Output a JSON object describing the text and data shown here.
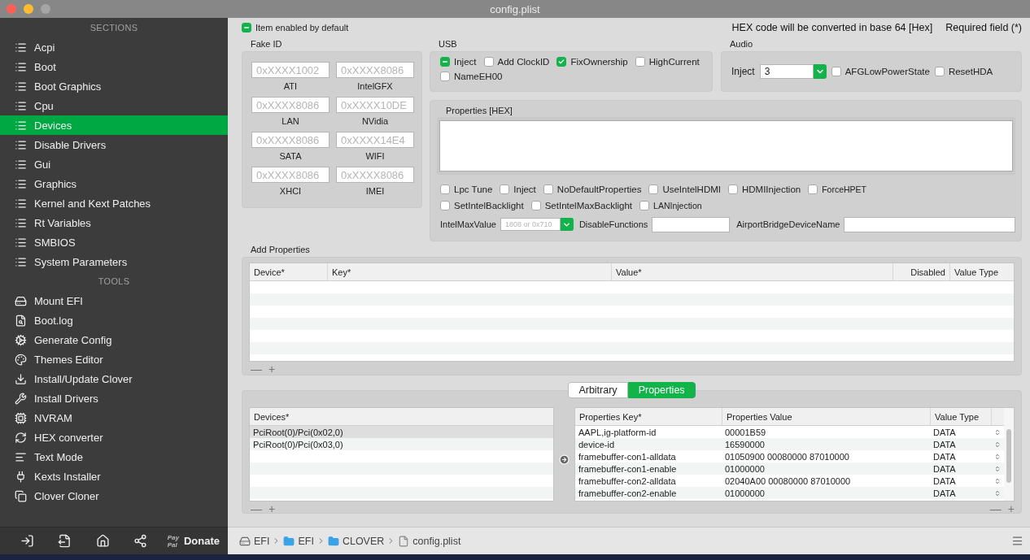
{
  "window": {
    "title": "config.plist"
  },
  "sidebar": {
    "sections_header": "SECTIONS",
    "sections": [
      {
        "label": "Acpi",
        "selected": false
      },
      {
        "label": "Boot",
        "selected": false
      },
      {
        "label": "Boot Graphics",
        "selected": false
      },
      {
        "label": "Cpu",
        "selected": false
      },
      {
        "label": "Devices",
        "selected": true
      },
      {
        "label": "Disable Drivers",
        "selected": false
      },
      {
        "label": "Gui",
        "selected": false
      },
      {
        "label": "Graphics",
        "selected": false
      },
      {
        "label": "Kernel and Kext Patches",
        "selected": false
      },
      {
        "label": "Rt Variables",
        "selected": false
      },
      {
        "label": "SMBIOS",
        "selected": false
      },
      {
        "label": "System Parameters",
        "selected": false
      }
    ],
    "tools_header": "TOOLS",
    "tools": [
      "Mount EFI",
      "Boot.log",
      "Generate Config",
      "Themes Editor",
      "Install/Update Clover",
      "Install Drivers",
      "NVRAM",
      "HEX converter",
      "Text Mode",
      "Kexts Installer",
      "Clover Cloner"
    ],
    "donate": {
      "logo_top": "Pay",
      "logo_bottom": "Pal",
      "label": "Donate"
    }
  },
  "item_enabled": {
    "label": "Item enabled by default",
    "checked": true,
    "partial": true
  },
  "notes": [
    "HEX code will be converted in base 64 [Hex]",
    "Required field (*)"
  ],
  "fake_id": {
    "title": "Fake ID",
    "fields": [
      {
        "placeholder": "0xXXXX1002",
        "label": "ATI"
      },
      {
        "placeholder": "0xXXXX8086",
        "label": "IntelGFX"
      },
      {
        "placeholder": "0xXXXX8086",
        "label": "LAN"
      },
      {
        "placeholder": "0xXXXX10DE",
        "label": "NVidia"
      },
      {
        "placeholder": "0xXXXX8086",
        "label": "SATA"
      },
      {
        "placeholder": "0xXXXX14E4",
        "label": "WIFI"
      },
      {
        "placeholder": "0xXXXX8086",
        "label": "XHCI"
      },
      {
        "placeholder": "0xXXXX8086",
        "label": "IMEI"
      }
    ]
  },
  "usb": {
    "title": "USB",
    "options": [
      {
        "label": "Inject",
        "checked": true,
        "partial": true
      },
      {
        "label": "Add ClockID",
        "checked": false,
        "partial": false
      },
      {
        "label": "FixOwnership",
        "checked": true,
        "partial": false
      },
      {
        "label": "HighCurrent",
        "checked": false,
        "partial": false
      },
      {
        "label": "NameEH00",
        "checked": false,
        "partial": false
      }
    ]
  },
  "audio": {
    "title": "Audio",
    "inject_label": "Inject",
    "inject_value": "3",
    "options": [
      {
        "label": "AFGLowPowerState",
        "checked": false
      },
      {
        "label": "ResetHDA",
        "checked": false
      }
    ]
  },
  "properties_hex": {
    "title": "Properties [HEX]",
    "options_row_1": [
      {
        "label": "Lpc Tune",
        "checked": false
      },
      {
        "label": "Inject",
        "checked": false
      },
      {
        "label": "NoDefaultProperties",
        "checked": false
      },
      {
        "label": "UseIntelHDMI",
        "checked": false
      },
      {
        "label": "HDMIInjection",
        "checked": false
      },
      {
        "label": "ForceHPET",
        "checked": false
      }
    ],
    "options_row_2": [
      {
        "label": "SetIntelBacklight",
        "checked": false
      },
      {
        "label": "SetIntelMaxBacklight",
        "checked": false
      },
      {
        "label": "LANInjection",
        "checked": false
      }
    ],
    "intel_max_value": {
      "label": "IntelMaxValue",
      "placeholder": "1808 or 0x710"
    },
    "disable_functions": {
      "label": "DisableFunctions"
    },
    "airport_bridge": {
      "label": "AirportBridgeDeviceName"
    }
  },
  "add_properties": {
    "title": "Add Properties",
    "columns": [
      "Device*",
      "Key*",
      "Value*",
      "Disabled",
      "Value Type"
    ],
    "remove": "—",
    "add": "+"
  },
  "segments": [
    {
      "label": "Arbitrary",
      "selected": false
    },
    {
      "label": "Properties",
      "selected": true
    }
  ],
  "devices": {
    "column": "Devices*",
    "rows": [
      {
        "text": "PciRoot(0)/Pci(0x02,0)",
        "selected": true
      },
      {
        "text": "PciRoot(0)/Pci(0x03,0)",
        "selected": false
      }
    ],
    "remove": "—",
    "add": "+"
  },
  "properties": {
    "columns": [
      "Properties Key*",
      "Properties Value",
      "Value Type"
    ],
    "rows": [
      {
        "key": "AAPL,ig-platform-id",
        "value": "00001B59",
        "type": "DATA"
      },
      {
        "key": "device-id",
        "value": "16590000",
        "type": "DATA"
      },
      {
        "key": "framebuffer-con1-alldata",
        "value": "01050900 00080000 87010000",
        "type": "DATA"
      },
      {
        "key": "framebuffer-con1-enable",
        "value": "01000000",
        "type": "DATA"
      },
      {
        "key": "framebuffer-con2-alldata",
        "value": "02040A00 00080000 87010000",
        "type": "DATA"
      },
      {
        "key": "framebuffer-con2-enable",
        "value": "01000000",
        "type": "DATA"
      }
    ],
    "remove": "—",
    "add": "+"
  },
  "path": [
    {
      "label": "EFI",
      "kind": "drive"
    },
    {
      "label": "EFI",
      "kind": "folder"
    },
    {
      "label": "CLOVER",
      "kind": "folder"
    },
    {
      "label": "config.plist",
      "kind": "file"
    }
  ]
}
